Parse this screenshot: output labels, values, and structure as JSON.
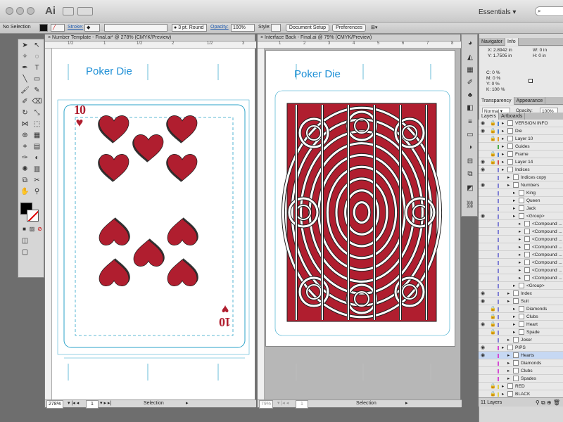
{
  "app": {
    "logo": "Ai",
    "workspace": "Essentials",
    "search_placeholder": ""
  },
  "control_bar": {
    "selection": "No Selection",
    "stroke_label": "Stroke:",
    "brush_value": "3 pt. Round",
    "opacity_label": "Opacity:",
    "opacity_value": "100%",
    "style_label": "Style:",
    "document_setup": "Document Setup",
    "preferences": "Preferences"
  },
  "doc1": {
    "tab_title": "× Number Template - Final.ai* @ 278% (CMYK/Preview)",
    "ruler_marks": [
      "1/2",
      "1",
      "1/2",
      "2",
      "1/2",
      "3"
    ],
    "artboard_title": "Poker Die",
    "rank": "10",
    "suit_symbol": "♥",
    "zoom": "278%",
    "page": "1",
    "status": "Selection"
  },
  "doc2": {
    "tab_title": "× Interface Back - Final.ai @ 79% (CMYK/Preview)",
    "ruler_marks": [
      "1",
      "2",
      "3",
      "4",
      "5",
      "6",
      "7",
      "8"
    ],
    "artboard_title": "Poker Die",
    "zoom": "79%",
    "page": "1",
    "status": "Selection"
  },
  "colors": {
    "heart": "#b01e2f",
    "title_blue": "#1d8fd6",
    "guide_cyan": "#2ba3c9"
  },
  "navigator": {
    "tabs": [
      "Navigator",
      "Info"
    ],
    "x": "X: 2.8942 in",
    "y": "Y: 1.7505 in",
    "w": "W: 0 in",
    "h": "H: 0 in",
    "c": "C: 0 %",
    "m": "M: 0 %",
    "yy": "Y: 0 %",
    "k": "K: 100 %"
  },
  "transparency": {
    "tabs": [
      "Transparency",
      "Appearance"
    ],
    "mode": "Normal",
    "opacity_label": "Opacity:",
    "opacity_value": "100%"
  },
  "layers_panel": {
    "tabs": [
      "Layers",
      "Artboards"
    ],
    "rows": [
      {
        "name": "VERSION INFO",
        "indent": 0,
        "eye": true,
        "lock": true,
        "color": "#4a7fd4"
      },
      {
        "name": "Die",
        "indent": 0,
        "eye": true,
        "lock": true,
        "color": "#4a7fd4"
      },
      {
        "name": "Layer 10",
        "indent": 0,
        "eye": false,
        "lock": true,
        "color": "#e29b2a"
      },
      {
        "name": "Guides",
        "indent": 0,
        "eye": false,
        "lock": false,
        "color": "#4ab04a"
      },
      {
        "name": "Frame",
        "indent": 0,
        "eye": false,
        "lock": true,
        "color": "#4a7fd4"
      },
      {
        "name": "Layer 14",
        "indent": 0,
        "eye": true,
        "lock": true,
        "color": "#d44a4a"
      },
      {
        "name": "Indices",
        "indent": 0,
        "eye": true,
        "lock": false,
        "color": "#7e7ed4"
      },
      {
        "name": "Indices copy",
        "indent": 1,
        "eye": false,
        "lock": false,
        "color": "#7e7ed4"
      },
      {
        "name": "Numbers",
        "indent": 1,
        "eye": true,
        "lock": false,
        "color": "#7e7ed4"
      },
      {
        "name": "King",
        "indent": 2,
        "eye": false,
        "lock": false,
        "color": "#7e7ed4"
      },
      {
        "name": "Queen",
        "indent": 2,
        "eye": false,
        "lock": false,
        "color": "#7e7ed4"
      },
      {
        "name": "Jack",
        "indent": 2,
        "eye": false,
        "lock": false,
        "color": "#7e7ed4"
      },
      {
        "name": "<Group>",
        "indent": 2,
        "eye": true,
        "lock": false,
        "color": "#7e7ed4"
      },
      {
        "name": "<Compound ...",
        "indent": 3,
        "eye": false,
        "lock": false,
        "color": "#7e7ed4"
      },
      {
        "name": "<Compound ...",
        "indent": 3,
        "eye": false,
        "lock": false,
        "color": "#7e7ed4"
      },
      {
        "name": "<Compound ...",
        "indent": 3,
        "eye": false,
        "lock": false,
        "color": "#7e7ed4"
      },
      {
        "name": "<Compound ...",
        "indent": 3,
        "eye": false,
        "lock": false,
        "color": "#7e7ed4"
      },
      {
        "name": "<Compound ...",
        "indent": 3,
        "eye": false,
        "lock": false,
        "color": "#7e7ed4"
      },
      {
        "name": "<Compound ...",
        "indent": 3,
        "eye": false,
        "lock": false,
        "color": "#7e7ed4"
      },
      {
        "name": "<Compound ...",
        "indent": 3,
        "eye": false,
        "lock": false,
        "color": "#7e7ed4"
      },
      {
        "name": "<Compound ...",
        "indent": 3,
        "eye": false,
        "lock": false,
        "color": "#7e7ed4"
      },
      {
        "name": "<Group>",
        "indent": 2,
        "eye": false,
        "lock": false,
        "color": "#7e7ed4"
      },
      {
        "name": "Index",
        "indent": 1,
        "eye": true,
        "lock": false,
        "color": "#7e7ed4"
      },
      {
        "name": "Suit",
        "indent": 1,
        "eye": true,
        "lock": false,
        "color": "#7e7ed4"
      },
      {
        "name": "Diamonds",
        "indent": 2,
        "eye": false,
        "lock": true,
        "color": "#7e7ed4"
      },
      {
        "name": "Clubs",
        "indent": 2,
        "eye": false,
        "lock": true,
        "color": "#7e7ed4"
      },
      {
        "name": "Heart",
        "indent": 2,
        "eye": true,
        "lock": true,
        "color": "#7e7ed4"
      },
      {
        "name": "Spade",
        "indent": 2,
        "eye": false,
        "lock": true,
        "color": "#7e7ed4"
      },
      {
        "name": "Joker",
        "indent": 1,
        "eye": false,
        "lock": false,
        "color": "#7e7ed4"
      },
      {
        "name": "PIPS",
        "indent": 0,
        "eye": true,
        "lock": false,
        "color": "#d44ad4"
      },
      {
        "name": "Hearts",
        "indent": 1,
        "eye": true,
        "lock": false,
        "color": "#d44ad4",
        "selected": true
      },
      {
        "name": "Diamonds",
        "indent": 1,
        "eye": false,
        "lock": false,
        "color": "#d44ad4"
      },
      {
        "name": "Clubs",
        "indent": 1,
        "eye": false,
        "lock": false,
        "color": "#d44ad4"
      },
      {
        "name": "Spades",
        "indent": 1,
        "eye": false,
        "lock": false,
        "color": "#d44ad4"
      },
      {
        "name": "RED",
        "indent": 0,
        "eye": false,
        "lock": true,
        "color": "#e0d04a"
      },
      {
        "name": "BLACK",
        "indent": 0,
        "eye": false,
        "lock": true,
        "color": "#e0d04a"
      }
    ],
    "footer": "11 Layers"
  }
}
